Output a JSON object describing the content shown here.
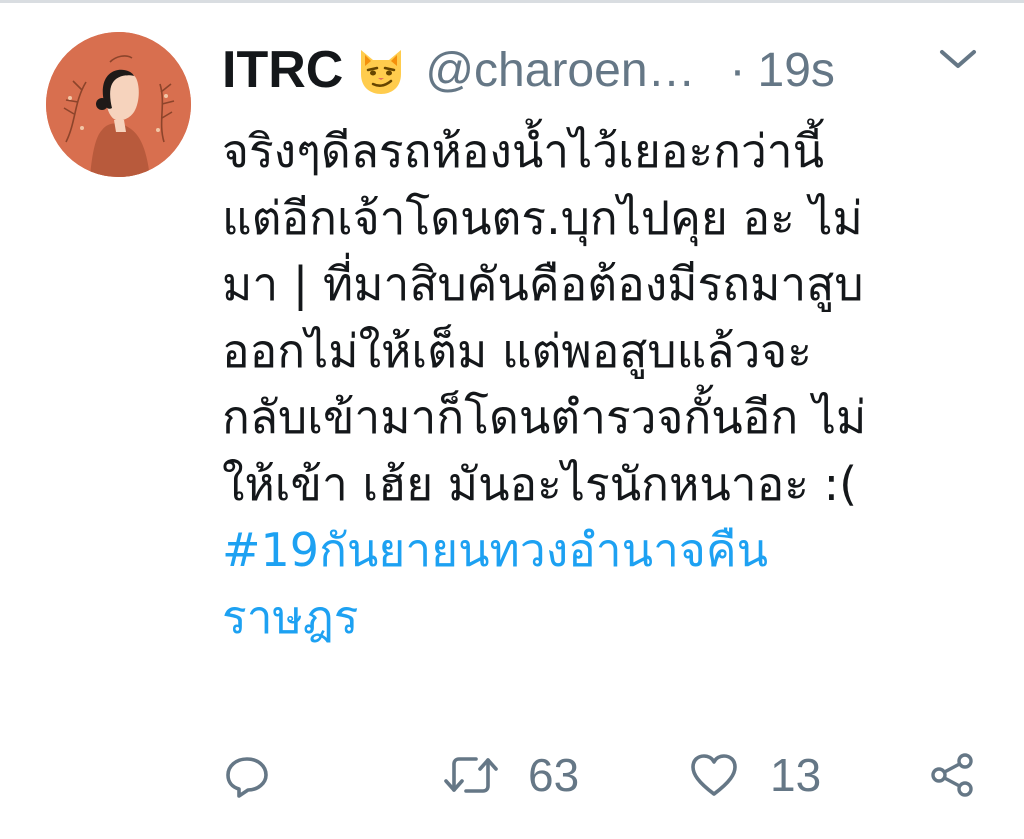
{
  "tweet": {
    "display_name": "ITRC",
    "emoji": "smirking-cat-emoji",
    "handle": "@charoen…",
    "separator": "·",
    "time": "19s",
    "text_lines": [
      "จริงๆดีลรถห้องน้ำไว้เยอะกว่านี้",
      "แต่อีกเจ้าโดนตร.บุกไปคุย อะ ไม่",
      "มา | ที่มาสิบคันคือต้องมีรถมาสูบ",
      "ออกไม่ให้เต็ม แต่พอสูบแล้วจะ",
      "กลับเข้ามาก็โดนตำรวจกั้นอีก ไม่",
      "ให้เข้า เฮ้ย มันอะไรนักหนาอะ :("
    ],
    "hashtag_lines": [
      "#19กันยายนทวงอำนาจคืน",
      "ราษฎร"
    ]
  },
  "actions": {
    "reply_icon": "reply-icon",
    "retweet_icon": "retweet-icon",
    "retweet_count": "63",
    "like_icon": "heart-icon",
    "like_count": "13",
    "share_icon": "share-icon"
  },
  "colors": {
    "text": "#14171a",
    "secondary": "#657786",
    "link": "#1da1f2",
    "avatar_bg": "#d86f4f"
  }
}
